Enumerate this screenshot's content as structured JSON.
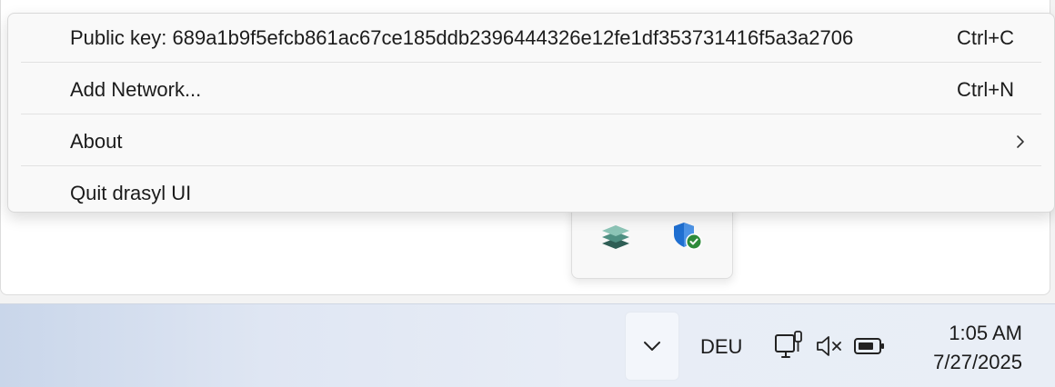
{
  "context_menu": {
    "items": [
      {
        "label": "Public key: 689a1b9f5efcb861ac67ce185ddb2396444326e12fe1df353731416f5a3a2706",
        "shortcut": "Ctrl+C"
      },
      {
        "label": "Add Network...",
        "shortcut": "Ctrl+N"
      },
      {
        "label": "About",
        "has_submenu": true,
        "submenu_icon": "chevron-right-icon"
      },
      {
        "label": "Quit drasyl UI"
      }
    ]
  },
  "tray_flyout": {
    "icons": [
      "drasyl-layers-icon",
      "windows-defender-shield-icon"
    ]
  },
  "taskbar": {
    "overflow_icon": "chevron-down-icon",
    "language": "DEU",
    "system_icons": [
      "network-wired-icon",
      "speaker-muted-icon",
      "battery-icon"
    ],
    "time": "1:05 AM",
    "date": "7/27/2025"
  },
  "colors": {
    "menu_bg": "#f9f9f9",
    "taskbar_start": "#c9d6ea",
    "taskbar_end": "#e9eef6",
    "defender_blue": "#1f6fd1",
    "check_green": "#2e8b3a",
    "layers_teal": "#3e7f73"
  }
}
